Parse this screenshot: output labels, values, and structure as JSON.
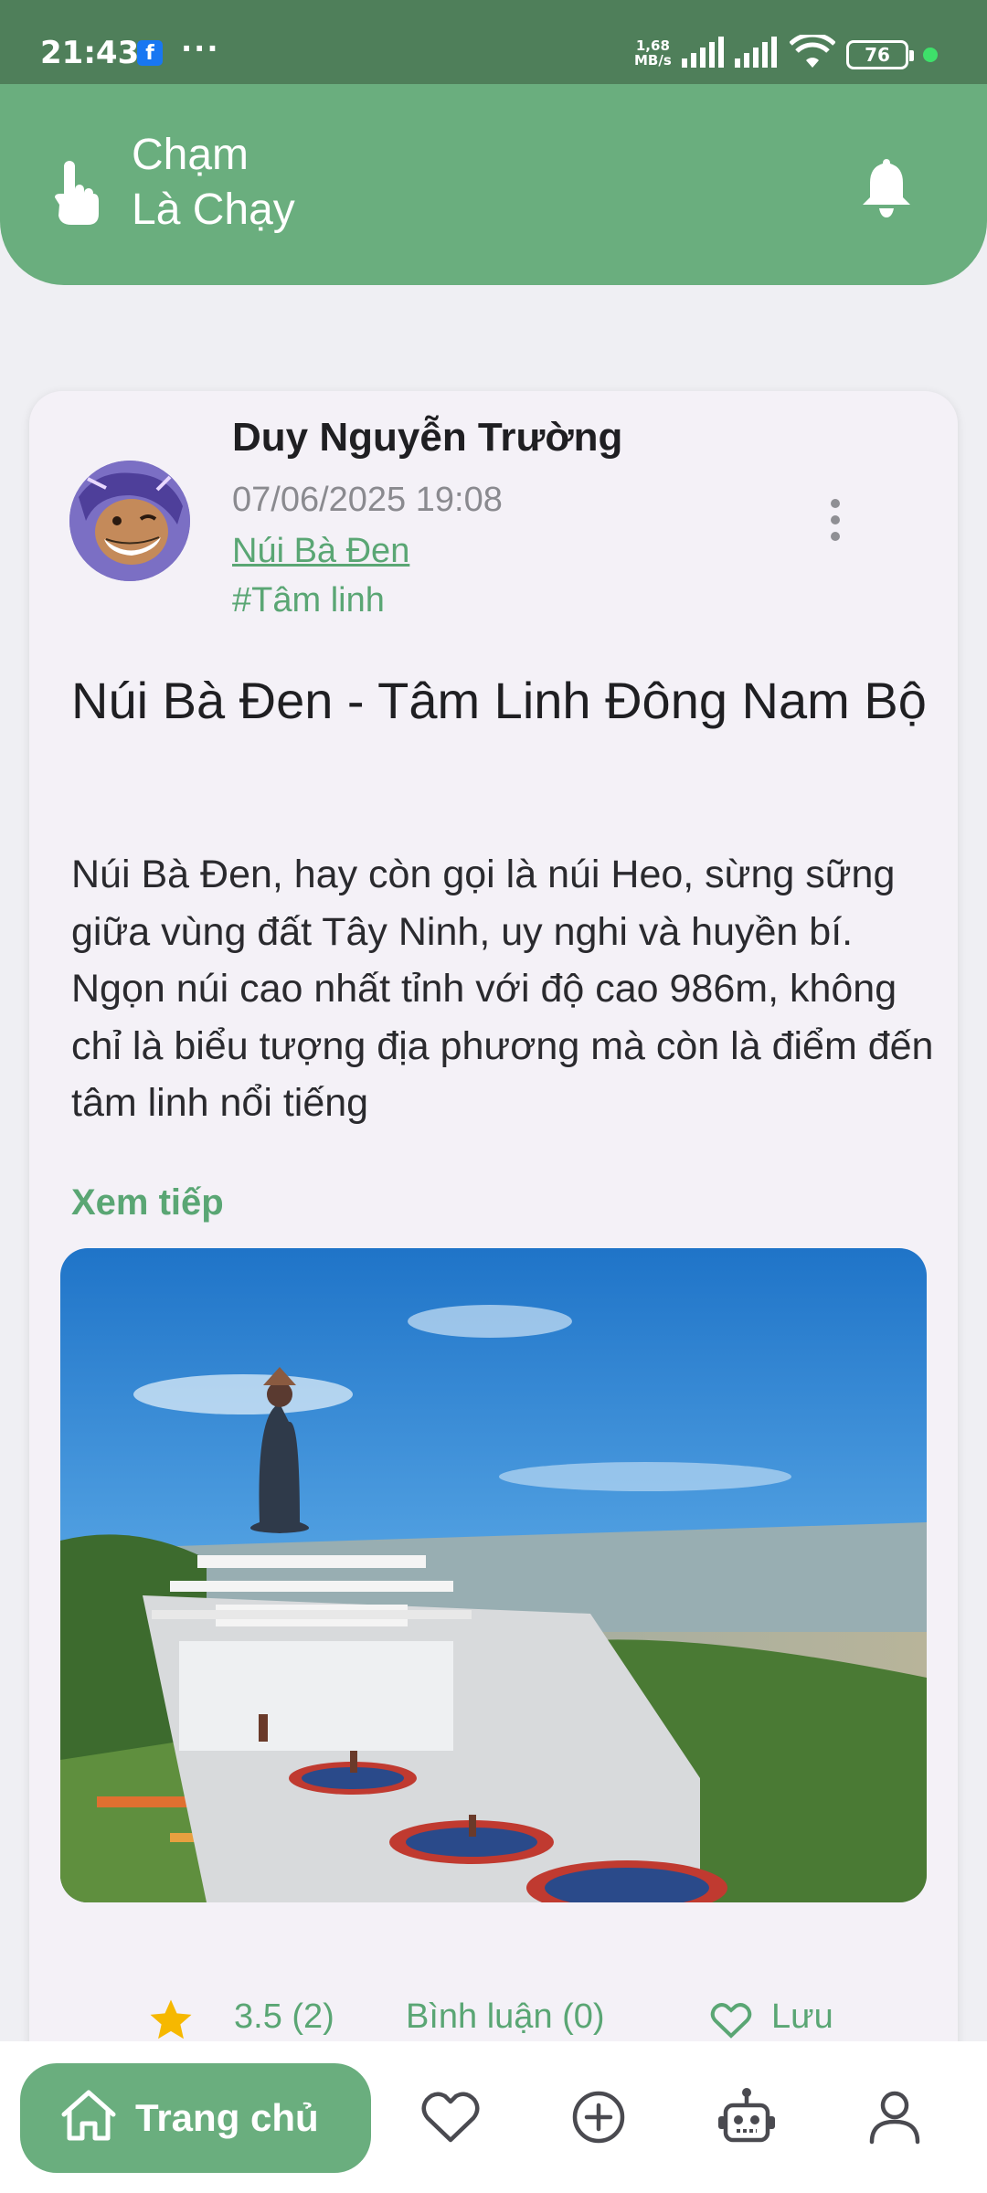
{
  "status_bar": {
    "time": "21:43",
    "notification_icon": "facebook-icon",
    "more": "···",
    "net_speed_value": "1,68",
    "net_speed_unit": "MB/s",
    "battery": "76"
  },
  "header": {
    "title_line1": "Chạm",
    "title_line2": "Là Chạy",
    "left_icon": "hand-tap-icon",
    "right_icon": "bell-icon"
  },
  "post": {
    "author": "Duy Nguyễn Trường",
    "datetime": "07/06/2025 19:08",
    "location": "Núi Bà Đen",
    "tag": "#Tâm linh",
    "title": "Núi Bà Đen - Tâm Linh Đông Nam Bộ",
    "body": "Núi Bà Đen, hay còn gọi là núi Heo, sừng sững giữa vùng đất Tây Ninh, uy nghi và huyền bí. Ngọn núi cao nhất tỉnh với độ cao 986m, không chỉ là biểu tượng địa phương mà còn là điểm đến tâm linh nổi tiếng",
    "read_more": "Xem tiếp",
    "rating": "3.5 (2)",
    "comments": "Bình luận (0)",
    "save": "Lưu"
  },
  "bottom_nav": {
    "home_label": "Trang chủ",
    "items": [
      "heart-icon",
      "add-circle-icon",
      "robot-icon",
      "profile-icon"
    ]
  },
  "colors": {
    "primary": "#6aae7e",
    "status_bar": "#4f7f5a",
    "accent_text": "#5aa674",
    "card": "#f4f1f7"
  }
}
